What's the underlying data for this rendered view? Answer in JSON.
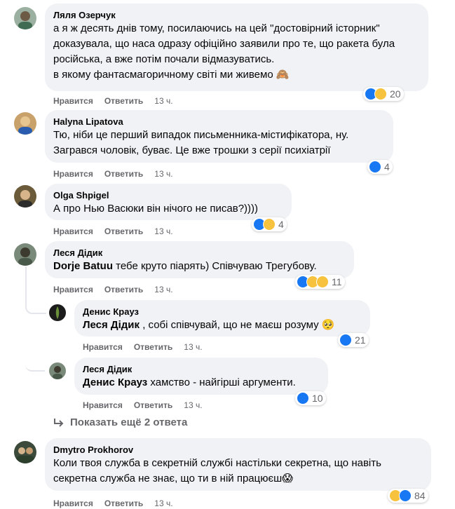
{
  "actions": {
    "like": "Нравится",
    "reply": "Ответить"
  },
  "comments": [
    {
      "author": "Ляля Озерчук",
      "text": "а я ж десять днів тому, посилаючись на цей \"достовірний історник\" доказувала, що наса одразу офіційно заявили про те, що ракета була російська, а вже потім почали відмазуватись.\nв якому фантасмагоричному світі ми живемо 🙈",
      "time": "13 ч.",
      "reactions": [
        "like",
        "sad"
      ],
      "count": "20"
    },
    {
      "author": "Halyna Lipatova",
      "text": "Тю, ніби це перший випадок письменника-містифікатора, ну.\nЗагрався чоловік, буває. Це вже трошки з серії психіатрії",
      "time": "13 ч.",
      "reactions": [
        "like"
      ],
      "count": "4"
    },
    {
      "author": "Olga Shpigel",
      "text": "А про Нью Васюки він нічого не писав?))))",
      "time": "13 ч.",
      "reactions": [
        "like",
        "haha"
      ],
      "count": "4"
    },
    {
      "author": "Леся Дідик",
      "mention": "Dorje Batuu",
      "text": " тебе круто піарять) Співчуваю Трегубову.",
      "time": "13 ч.",
      "reactions": [
        "like",
        "haha",
        "wow"
      ],
      "count": "11"
    },
    {
      "author": "Денис Крауз",
      "mention": "Леся Дідик",
      "text": " , собі співчувай, що не маєш розуму 🥺",
      "time": "13 ч.",
      "reactions": [
        "like"
      ],
      "count": "21"
    },
    {
      "author": "Леся Дідик",
      "mention": "Денис Крауз",
      "text": " хамство - найгірші аргументи.",
      "time": "13 ч.",
      "reactions": [
        "like"
      ],
      "count": "10"
    },
    {
      "author": "Dmytro Prokhorov",
      "text": "Коли твоя служба в секретній службі настільки секретна, що навіть секретна служба не знає, що ти в ній працюєш😱",
      "time": "13 ч.",
      "reactions": [
        "haha",
        "like"
      ],
      "count": "84"
    }
  ],
  "show_more": "Показать ещё 2 ответа",
  "colors": {
    "bubble": "#f0f2f5",
    "meta": "#65676b",
    "like": "#1877f2",
    "emoji": "#f7c23e"
  }
}
